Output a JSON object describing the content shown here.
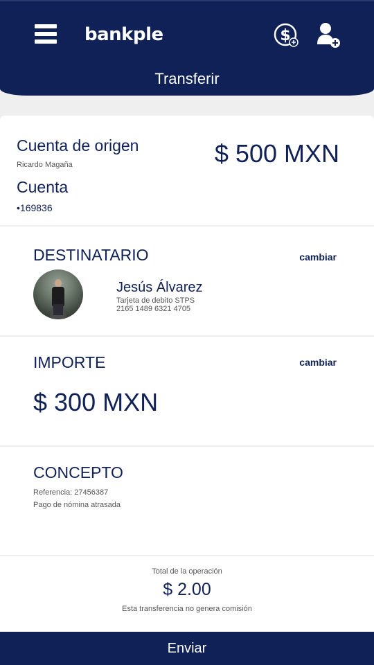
{
  "header": {
    "logo_text": "bankple",
    "title": "Transferir",
    "icons": {
      "menu": "menu-icon",
      "money": "money-add-icon",
      "user": "user-add-icon"
    }
  },
  "origin": {
    "title": "Cuenta de origen",
    "owner": "Ricardo Magaña",
    "balance": "$ 500 MXN",
    "account_label": "Cuenta",
    "account_number": "•169836"
  },
  "recipient": {
    "title": "DESTINATARIO",
    "change_label": "cambiar",
    "name": "Jesús Álvarez",
    "card_type": "Tarjeta de debito STPS",
    "card_number": "2165 1489 6321 4705"
  },
  "amount": {
    "title": "IMPORTE",
    "change_label": "cambiar",
    "value": "$ 300 MXN"
  },
  "concept": {
    "title": "CONCEPTO",
    "reference": "Referencia: 27456387",
    "description": "Pago de nómina atrasada"
  },
  "total": {
    "label": "Total de la operación",
    "value": "$ 2.00",
    "note": "Esta transferencia no genera comisión"
  },
  "actions": {
    "send_label": "Enviar"
  },
  "colors": {
    "primary": "#0f2156",
    "background": "#efefef",
    "card": "#ffffff"
  }
}
